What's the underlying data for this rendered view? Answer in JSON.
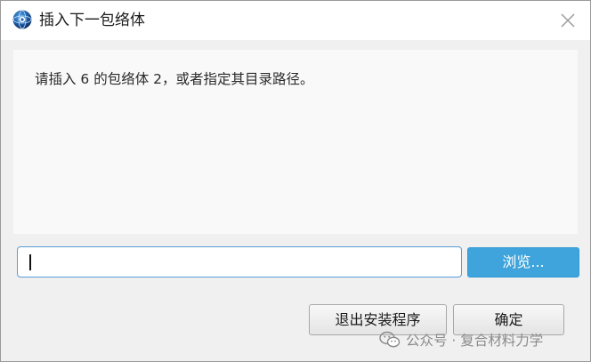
{
  "titlebar": {
    "title": "插入下一包络体",
    "app_icon": "blue-globe-app-icon",
    "close_icon": "close-icon"
  },
  "message": {
    "text": "请插入 6 的包络体 2，或者指定其目录路径。"
  },
  "path_input": {
    "value": "",
    "placeholder": ""
  },
  "buttons": {
    "browse_label": "浏览...",
    "exit_label": "退出安装程序",
    "ok_label": "确定"
  },
  "watermark": {
    "text": "公众号 · 复合材料力学",
    "icon": "wechat-icon"
  },
  "colors": {
    "accent": "#3fa4dc",
    "input_focus_border": "#5a9bd6"
  }
}
